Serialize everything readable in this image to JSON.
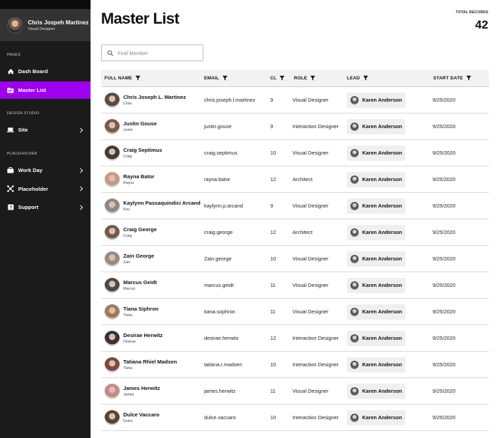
{
  "sidebar": {
    "user": {
      "name": "Chris Jospeh Martinez",
      "role": "Visual Designer"
    },
    "sections": [
      {
        "label": "PAGES",
        "items": [
          {
            "label": "Dash Board",
            "icon": "home-icon",
            "active": false,
            "chevron": false
          },
          {
            "label": "Master List",
            "icon": "folder-icon",
            "active": true,
            "chevron": false
          }
        ]
      },
      {
        "label": "DESIGN STUDIO",
        "items": [
          {
            "label": "Site",
            "icon": "laptop-icon",
            "active": false,
            "chevron": true
          }
        ]
      },
      {
        "label": "PLACEHOLDER",
        "items": [
          {
            "label": "Work Day",
            "icon": "briefcase-icon",
            "active": false,
            "chevron": true
          },
          {
            "label": "Placeholder",
            "icon": "network-icon",
            "active": false,
            "chevron": true
          },
          {
            "label": "Support",
            "icon": "help-icon",
            "active": false,
            "chevron": true
          }
        ]
      }
    ]
  },
  "header": {
    "title": "Master List",
    "records_label": "TOTAL RECORDS",
    "records_count": "42"
  },
  "search": {
    "placeholder": "Find Member"
  },
  "table": {
    "columns": [
      "FULL NAME",
      "EMAIL",
      "CL",
      "ROLE",
      "LEAD",
      "START DATE"
    ],
    "rows": [
      {
        "name": "Chris Joseph L. Martinez",
        "short": "Chris",
        "email": "chris.joseph.l.martinez",
        "cl": "9",
        "role": "Visual Designer",
        "lead": "Karen Anderson",
        "start": "9/25/2020"
      },
      {
        "name": "Justin Gouse",
        "short": "Justin",
        "email": "justin.gouse",
        "cl": "9",
        "role": "Interaction Designer",
        "lead": "Karen Anderson",
        "start": "9/25/2020"
      },
      {
        "name": "Craig Septimus",
        "short": "Craig",
        "email": "craig.septimus",
        "cl": "10",
        "role": "Visual Designer",
        "lead": "Karen Anderson",
        "start": "9/25/2020"
      },
      {
        "name": "Rayna Bator",
        "short": "Rayna",
        "email": "rayna.bator",
        "cl": "12",
        "role": "Architect",
        "lead": "Karen Anderson",
        "start": "9/25/2020"
      },
      {
        "name": "Kaylynn Passaquindici Arcand",
        "short": "Kay",
        "email": "kaylynn.p.arcand",
        "cl": "9",
        "role": "Visual Designer",
        "lead": "Karen Anderson",
        "start": "9/25/2020"
      },
      {
        "name": "Craig George",
        "short": "Craig",
        "email": "craig.george",
        "cl": "12",
        "role": "Architect",
        "lead": "Karen Anderson",
        "start": "9/25/2020"
      },
      {
        "name": "Zain George",
        "short": "Zain",
        "email": "Zain.george",
        "cl": "10",
        "role": "Visual Designer",
        "lead": "Karen Anderson",
        "start": "9/25/2020"
      },
      {
        "name": "Marcus Geidt",
        "short": "Marcus",
        "email": "marcus.geidt",
        "cl": "11",
        "role": "Visual Designer",
        "lead": "Karen Anderson",
        "start": "9/25/2020"
      },
      {
        "name": "Tiana Siphron",
        "short": "Tiana",
        "email": "tiana.sophron",
        "cl": "11",
        "role": "Visual Designer",
        "lead": "Karen Anderson",
        "start": "9/25/2020"
      },
      {
        "name": "Desirae Herwitz",
        "short": "Desirae",
        "email": "desirae.herwitz",
        "cl": "12",
        "role": "Interaction Designer",
        "lead": "Karen Anderson",
        "start": "9/25/2020"
      },
      {
        "name": "Tatiana Rhiel Madsen",
        "short": "Tiana",
        "email": "tatiana.r.madsen",
        "cl": "10",
        "role": "Interaction Designer",
        "lead": "Karen Anderson",
        "start": "9/25/2020"
      },
      {
        "name": "James Herwitz",
        "short": "James",
        "email": "james.herwitz",
        "cl": "11",
        "role": "Visual Designer",
        "lead": "Karen Anderson",
        "start": "9/25/2020"
      },
      {
        "name": "Dulce Vaccaro",
        "short": "Dulce",
        "email": "dulce.vaccaro",
        "cl": "10",
        "role": "Interaction Designer",
        "lead": "Karen Anderson",
        "start": "9/25/2020"
      }
    ]
  },
  "colors": {
    "accent": "#a000f0",
    "sidebar_bg": "#1b1b1b",
    "profile_bg": "#333333"
  }
}
